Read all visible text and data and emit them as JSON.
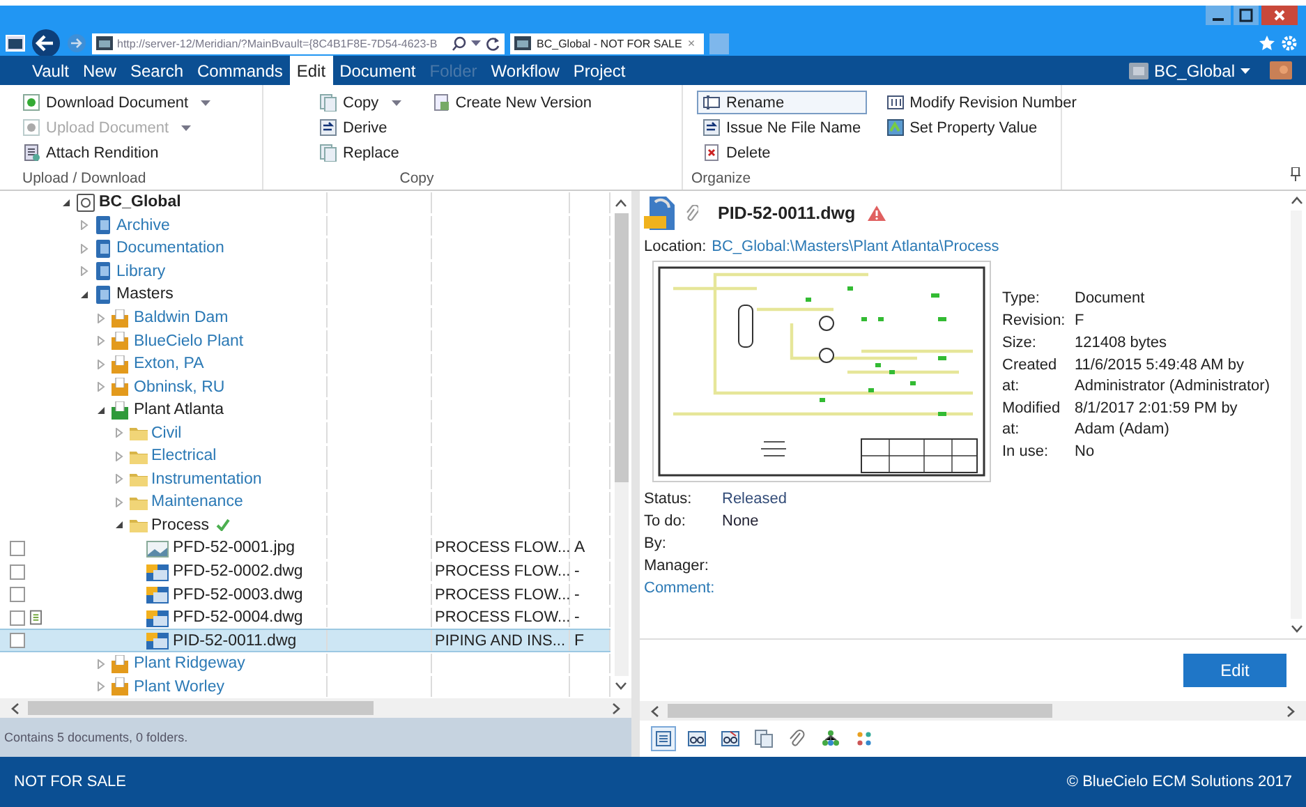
{
  "browser": {
    "address": "http://server-12/Meridian/?MainBvault={8C4B1F8E-7D54-4623-B",
    "tab_title": "BC_Global - NOT FOR SALE",
    "tab_close": "×"
  },
  "menu": {
    "tabs": [
      {
        "label": "Vault",
        "selected": false,
        "disabled": false
      },
      {
        "label": "New",
        "selected": false,
        "disabled": false
      },
      {
        "label": "Search",
        "selected": false,
        "disabled": false
      },
      {
        "label": "Commands",
        "selected": false,
        "disabled": false
      },
      {
        "label": "Edit",
        "selected": true,
        "disabled": false
      },
      {
        "label": "Document",
        "selected": false,
        "disabled": false
      },
      {
        "label": "Folder",
        "selected": false,
        "disabled": true
      },
      {
        "label": "Workflow",
        "selected": false,
        "disabled": false
      },
      {
        "label": "Project",
        "selected": false,
        "disabled": false
      }
    ],
    "vault_selector": "BC_Global"
  },
  "ribbon": {
    "groups": [
      {
        "label": "Upload / Download",
        "columns": [
          [
            {
              "label": "Download Document",
              "kind": "download",
              "dropdown": true,
              "disabled": false,
              "hover": false
            },
            {
              "label": "Upload Document",
              "kind": "upload",
              "dropdown": true,
              "disabled": true,
              "hover": false
            },
            {
              "label": "Attach Rendition",
              "kind": "attach",
              "dropdown": false,
              "disabled": false,
              "hover": false
            }
          ]
        ]
      },
      {
        "label": "Copy",
        "columns": [
          [
            {
              "label": "Copy",
              "kind": "copy",
              "dropdown": true,
              "disabled": false,
              "hover": false
            },
            {
              "label": "Derive",
              "kind": "derive",
              "dropdown": false,
              "disabled": false,
              "hover": false
            },
            {
              "label": "Replace",
              "kind": "copy",
              "dropdown": false,
              "disabled": false,
              "hover": false
            }
          ],
          [
            {
              "label": "Create New Version",
              "kind": "version",
              "dropdown": false,
              "disabled": false,
              "hover": false
            }
          ]
        ]
      },
      {
        "label": "Organize",
        "columns": [
          [
            {
              "label": "Rename",
              "kind": "rename",
              "dropdown": false,
              "disabled": false,
              "hover": true
            },
            {
              "label": "Issue Ne File Name",
              "kind": "derive",
              "dropdown": false,
              "disabled": false,
              "hover": false
            },
            {
              "label": "Delete",
              "kind": "delete",
              "dropdown": false,
              "disabled": false,
              "hover": false
            }
          ],
          [
            {
              "label": "Modify Revision Number",
              "kind": "revision",
              "dropdown": false,
              "disabled": false,
              "hover": false
            },
            {
              "label": "Set Property Value",
              "kind": "property",
              "dropdown": false,
              "disabled": false,
              "hover": false
            }
          ]
        ]
      }
    ]
  },
  "tree": [
    {
      "label": "BC_Global",
      "kind": "vault",
      "expanded": true,
      "marked": false,
      "children": [
        {
          "label": "Archive",
          "kind": "cabinet",
          "expanded": false,
          "marked": false
        },
        {
          "label": "Documentation",
          "kind": "cabinet",
          "expanded": false,
          "marked": false
        },
        {
          "label": "Library",
          "kind": "cabinet",
          "expanded": false,
          "marked": false
        },
        {
          "label": "Masters",
          "kind": "cabinet",
          "expanded": true,
          "marked": false,
          "children": [
            {
              "label": "Baldwin Dam",
              "kind": "site",
              "expanded": false,
              "marked": false
            },
            {
              "label": "BlueCielo Plant",
              "kind": "site",
              "expanded": false,
              "marked": false
            },
            {
              "label": "Exton, PA",
              "kind": "site",
              "expanded": false,
              "marked": false
            },
            {
              "label": "Obninsk, RU",
              "kind": "site",
              "expanded": false,
              "marked": false
            },
            {
              "label": "Plant Atlanta",
              "kind": "site",
              "expanded": true,
              "marked": false,
              "children": [
                {
                  "label": "Civil",
                  "kind": "folder",
                  "expanded": false,
                  "marked": false
                },
                {
                  "label": "Electrical",
                  "kind": "folder",
                  "expanded": false,
                  "marked": false
                },
                {
                  "label": "Instrumentation",
                  "kind": "folder",
                  "expanded": false,
                  "marked": false
                },
                {
                  "label": "Maintenance",
                  "kind": "folder",
                  "expanded": false,
                  "marked": false
                },
                {
                  "label": "Process",
                  "kind": "folder",
                  "expanded": true,
                  "marked": true,
                  "children": [
                    {
                      "label": "PFD-52-0001.jpg",
                      "kind": "image",
                      "checked": false,
                      "has_note": false,
                      "selected": false,
                      "column_3": "PROCESS FLOW...",
                      "column_4": "A"
                    },
                    {
                      "label": "PFD-52-0002.dwg",
                      "kind": "drawing",
                      "checked": false,
                      "has_note": false,
                      "selected": false,
                      "column_3": "PROCESS FLOW...",
                      "column_4": "-"
                    },
                    {
                      "label": "PFD-52-0003.dwg",
                      "kind": "drawing",
                      "checked": false,
                      "has_note": false,
                      "selected": false,
                      "column_3": "PROCESS FLOW...",
                      "column_4": "-"
                    },
                    {
                      "label": "PFD-52-0004.dwg",
                      "kind": "drawing",
                      "checked": false,
                      "has_note": true,
                      "selected": false,
                      "column_3": "PROCESS FLOW...",
                      "column_4": "-"
                    },
                    {
                      "label": "PID-52-0011.dwg",
                      "kind": "drawing",
                      "checked": false,
                      "has_note": false,
                      "selected": true,
                      "column_3": "PIPING AND INS...",
                      "column_4": "F"
                    }
                  ]
                }
              ]
            },
            {
              "label": "Plant Ridgeway",
              "kind": "site",
              "expanded": false,
              "marked": false
            },
            {
              "label": "Plant Worley",
              "kind": "site",
              "expanded": false,
              "marked": false
            }
          ]
        }
      ]
    }
  ],
  "list_status": "Contains 5 documents, 0 folders.",
  "details": {
    "title": "PID-52-0011.dwg",
    "location_label": "Location:",
    "location": "BC_Global:\\Masters\\Plant Atlanta\\Process",
    "properties": [
      {
        "label": "Type:",
        "value": "Document"
      },
      {
        "label": "Revision:",
        "value": "F"
      },
      {
        "label": "Size:",
        "value": "121408 bytes"
      },
      {
        "label": "Created at:",
        "value": "11/6/2015 5:49:48 AM by Administrator (Administrator)"
      },
      {
        "label": "Modified at:",
        "value": "8/1/2017 2:01:59 PM by Adam (Adam)"
      },
      {
        "label": "In use:",
        "value": "No"
      }
    ],
    "workflow": [
      {
        "label": "Status:",
        "value": "Released",
        "kind": "field"
      },
      {
        "label": "To do:",
        "value": "None",
        "kind": "field"
      },
      {
        "label": "By:",
        "kind": "field"
      },
      {
        "label": "Manager:",
        "kind": "field"
      },
      {
        "label": "Comment:",
        "kind": "link"
      }
    ],
    "edit_button": "Edit",
    "view_tabs": [
      {
        "kind": "properties",
        "selected": true
      },
      {
        "kind": "viewer",
        "selected": false
      },
      {
        "kind": "redline",
        "selected": false
      },
      {
        "kind": "rendition",
        "selected": false
      },
      {
        "kind": "link",
        "selected": false
      },
      {
        "kind": "hierarchy",
        "selected": false
      },
      {
        "kind": "apps",
        "selected": false
      }
    ]
  },
  "footer": {
    "left": "NOT FOR SALE",
    "right": "© BlueCielo ECM Solutions 2017"
  }
}
